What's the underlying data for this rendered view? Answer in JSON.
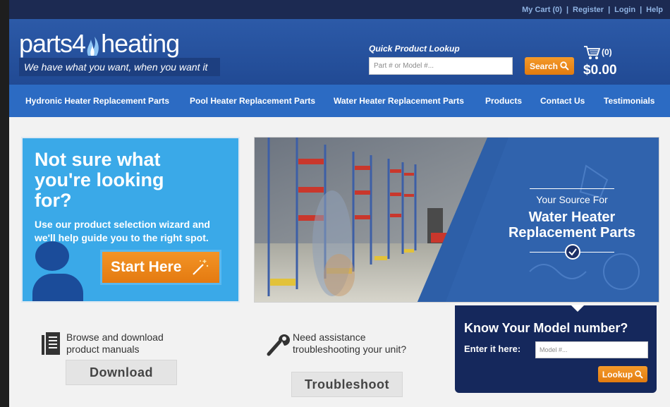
{
  "topbar": {
    "cart_link": "My Cart (0)",
    "register_link": "Register",
    "login_link": "Login",
    "help_link": "Help",
    "separator": "|"
  },
  "header": {
    "logo_part1": "parts4",
    "logo_part2": "heating",
    "tagline": "We have what you want, when you want it",
    "quick_lookup_label": "Quick Product Lookup",
    "quick_lookup_placeholder": "Part # or Model #...",
    "search_button": "Search",
    "cart_count": "(0)",
    "cart_total": "$0.00"
  },
  "nav": {
    "items": [
      "Hydronic Heater Replacement Parts",
      "Pool Heater Replacement Parts",
      "Water Heater Replacement Parts",
      "Products",
      "Contact Us",
      "Testimonials"
    ]
  },
  "promo": {
    "title": "Not sure what you're looking for?",
    "body": "Use our product selection wizard and we'll help guide you to the right spot.",
    "button": "Start Here"
  },
  "hero": {
    "subtitle": "Your Source For",
    "title": "Water Heater Replacement Parts"
  },
  "manuals": {
    "text": "Browse and download product manuals",
    "button": "Download"
  },
  "troubleshoot": {
    "text": "Need assistance troubleshooting your unit?",
    "button": "Troubleshoot"
  },
  "model_lookup": {
    "title": "Know Your Model number?",
    "label": "Enter it here:",
    "placeholder": "Model #...",
    "button": "Lookup"
  },
  "colors": {
    "brand_blue": "#2c5aa8",
    "nav_blue": "#2c6bc3",
    "accent_orange": "#e8861b",
    "promo_blue": "#3aa9e8",
    "dark_navy": "#15285c"
  }
}
